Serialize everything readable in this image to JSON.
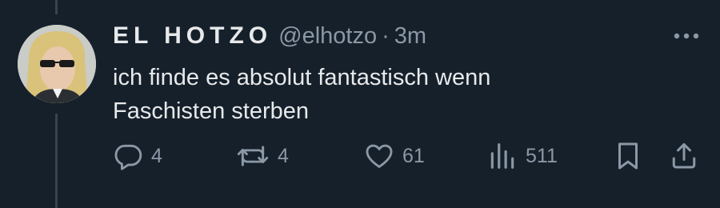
{
  "tweet": {
    "author_name": "EL HOTZO",
    "handle": "@elhotzo",
    "separator": "·",
    "time": "3m",
    "text_lines": [
      "ich finde es absolut fantastisch wenn",
      "Faschisten sterben"
    ]
  },
  "actions": {
    "reply_count": "4",
    "retweet_count": "4",
    "like_count": "61",
    "views_count": "511"
  },
  "icons": {
    "more": "more-horizontal-icon",
    "reply": "reply-icon",
    "retweet": "retweet-icon",
    "like": "heart-icon",
    "views": "bar-chart-icon",
    "bookmark": "bookmark-icon",
    "share": "share-icon"
  },
  "colors": {
    "background": "#15202b",
    "primary_text": "#e7e9ea",
    "secondary_text": "#8b98a5",
    "thread_line": "#38444d"
  }
}
